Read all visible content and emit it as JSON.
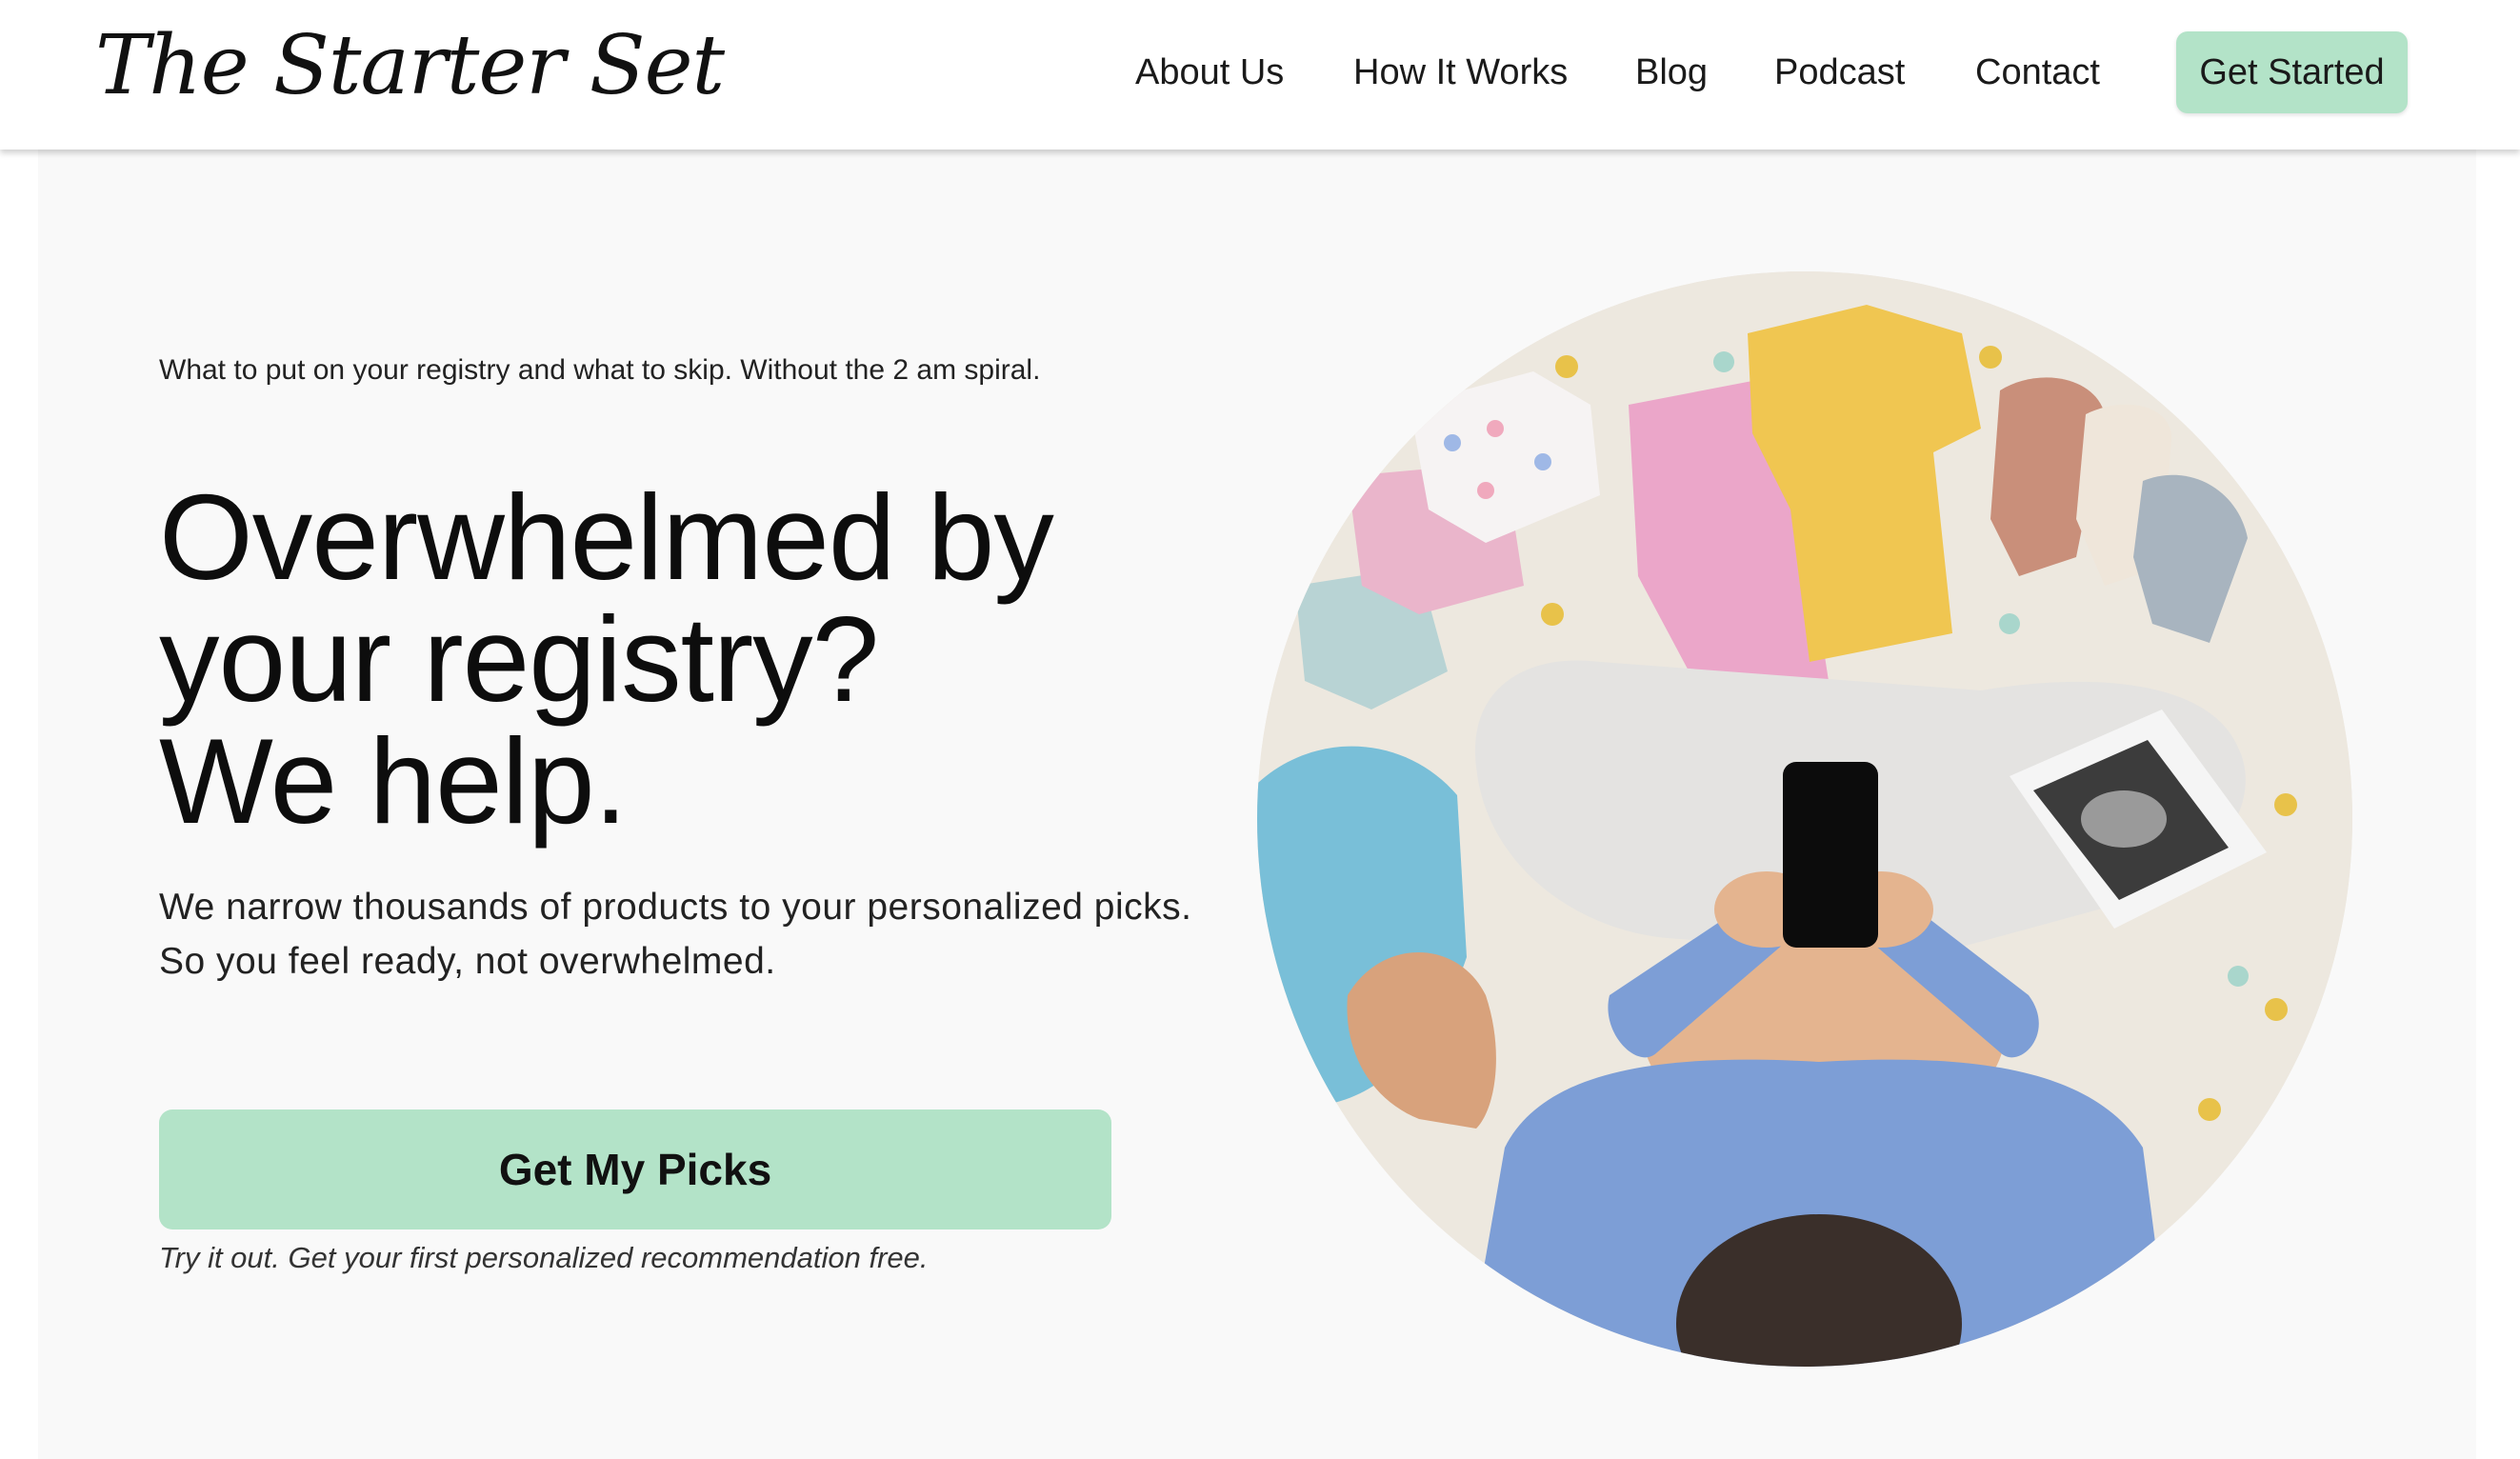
{
  "header": {
    "logo": "The Starter Set",
    "nav": [
      "About Us",
      "How It Works",
      "Blog",
      "Podcast",
      "Contact"
    ],
    "cta_label": "Get Started"
  },
  "hero": {
    "eyebrow": "What to put on your registry and what to skip. Without the 2 am spiral.",
    "headline_lines": [
      "Overwhelmed by",
      "your registry?",
      "We help."
    ],
    "subcopy_lines": [
      "We narrow thousands of products to your personalized picks.",
      "So you feel ready, not overwhelmed."
    ],
    "cta_label": "Get My Picks",
    "cta_note": "Try it out. Get your first personalized recommendation free."
  },
  "colors": {
    "accent": "#b3e3c8",
    "hero_background": "#f9f9f9",
    "text": "#111111"
  }
}
